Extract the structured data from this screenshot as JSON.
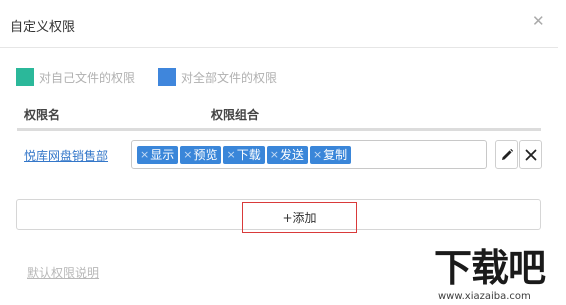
{
  "dialog": {
    "title": "自定义权限",
    "close_icon": "close-icon"
  },
  "legend": [
    {
      "label": "对自己文件的权限",
      "color": "#2bb89a"
    },
    {
      "label": "对全部文件的权限",
      "color": "#3f86dc"
    }
  ],
  "table": {
    "headers": [
      "权限名",
      "权限组合"
    ],
    "rows": [
      {
        "name": "悦库网盘销售部",
        "tags": [
          "显示",
          "预览",
          "下载",
          "发送",
          "复制"
        ],
        "edit_icon": "pencil-icon",
        "delete_icon": "close-icon"
      }
    ]
  },
  "actions": {
    "add_label": "+添加",
    "help_link": "默认权限说明"
  },
  "watermark": {
    "logo_text": "下载吧",
    "url": "www.xiazaiba.com"
  }
}
